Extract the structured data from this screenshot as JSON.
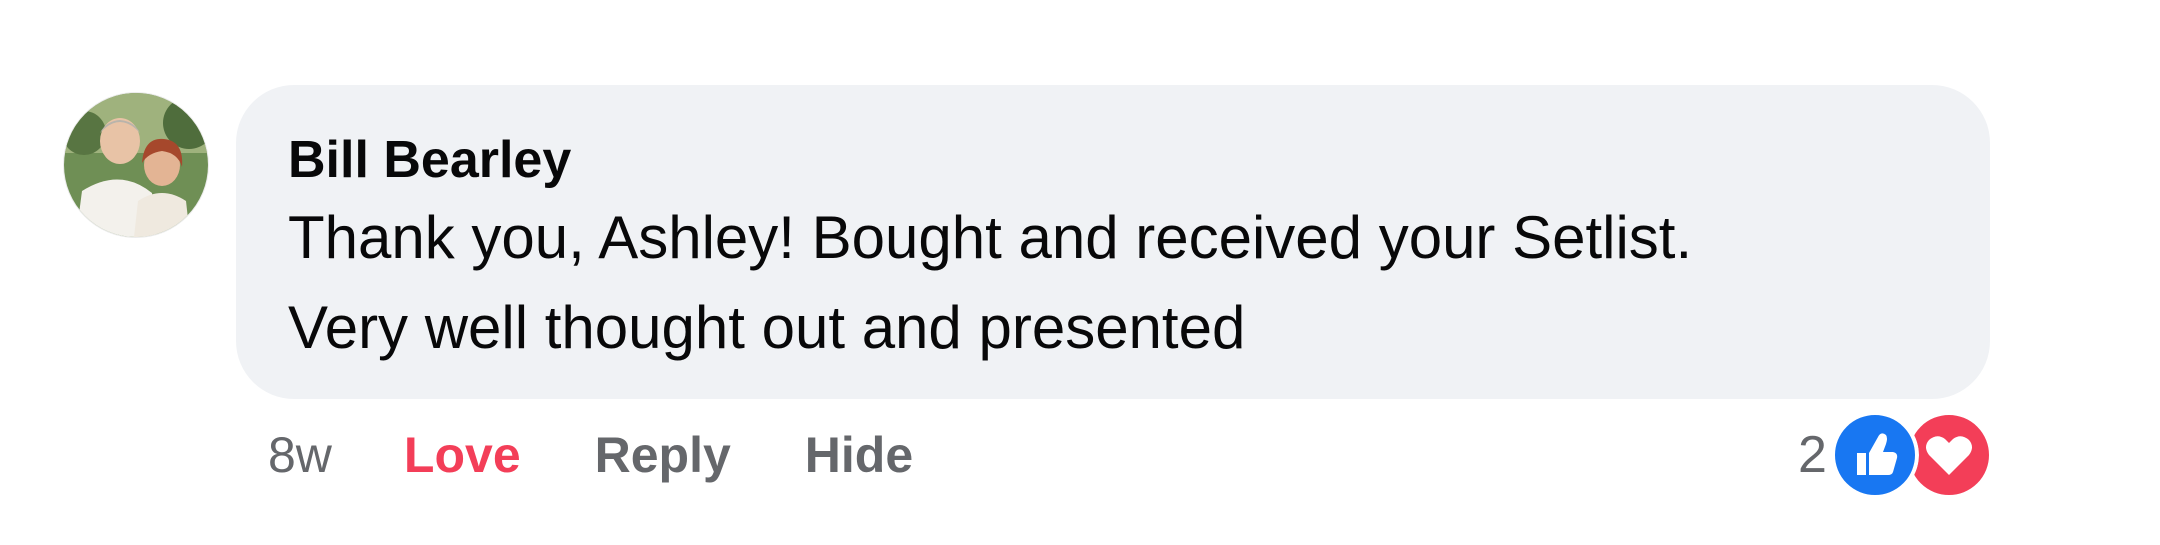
{
  "comment": {
    "author": "Bill Bearley",
    "text_lines": [
      "Thank you, Ashley! Bought and received your Setlist.",
      "Very well thought out and presented"
    ],
    "timestamp": "8w",
    "actions": {
      "love": "Love",
      "reply": "Reply",
      "hide": "Hide"
    },
    "reactions": {
      "count": "2",
      "icons": [
        "like-icon",
        "heart-icon"
      ]
    }
  },
  "colors": {
    "bubble": "#f0f2f5",
    "love": "#f33e58",
    "muted": "#65676b",
    "like": "#1877f2",
    "heart": "#f33e58"
  }
}
